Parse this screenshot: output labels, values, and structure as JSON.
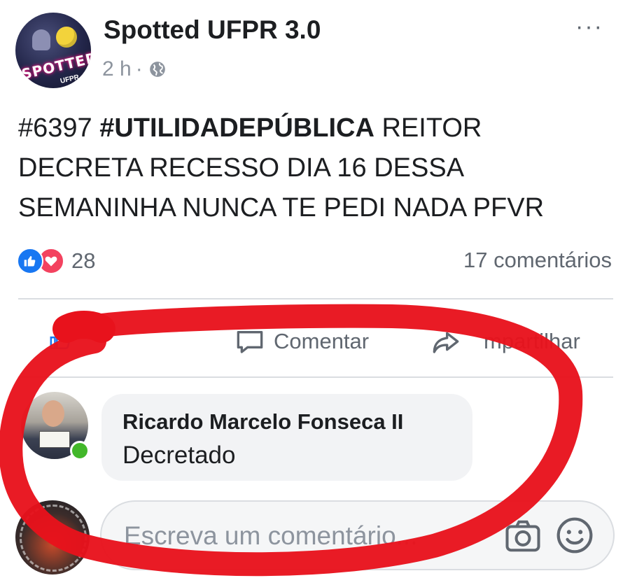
{
  "post": {
    "page_name": "Spotted UFPR 3.0",
    "time": "2 h",
    "separator": "·",
    "avatar_text": "SPOTTED",
    "avatar_subtext": "UFPR",
    "text_hashtag_number": "#6397",
    "text_hashtag_bold": "#UTILIDADEPÚBLICA",
    "text_body": "REITOR DECRETA RECESSO DIA 16 DESSA SEMANINHA NUNCA TE PEDI NADA PFVR",
    "reaction_count": "28",
    "comment_count": "17 comentários",
    "more_options": "···"
  },
  "actions": {
    "comment_label": "Comentar",
    "share_label": "mpartilhar"
  },
  "comment": {
    "author": "Ricardo Marcelo Fonseca II",
    "text": "Decretado"
  },
  "composer": {
    "placeholder": "Escreva um comentário..."
  },
  "colors": {
    "facebook_blue": "#1877f2",
    "love_red": "#f3425f",
    "online_green": "#42b72a",
    "annotation_red": "#e8121c"
  },
  "icons": [
    "globe-icon",
    "more-icon",
    "like-icon",
    "love-icon",
    "comment-icon",
    "share-icon",
    "camera-icon",
    "emoji-icon"
  ]
}
